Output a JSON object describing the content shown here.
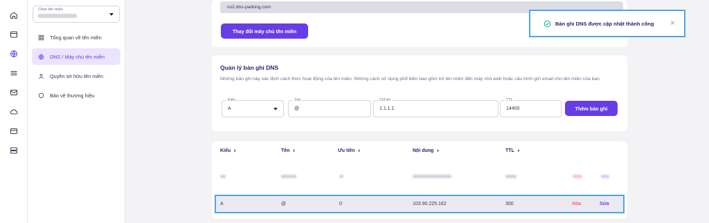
{
  "rail": {
    "icons": [
      "home-icon",
      "browser-icon",
      "globe-icon",
      "waves-icon",
      "mail-icon",
      "cloud-icon",
      "card-icon",
      "server-icon"
    ]
  },
  "sidebar": {
    "domain_select_label": "Chọn tên miền",
    "items": [
      {
        "label": "Tổng quan về tên miền",
        "icon": "grid-icon"
      },
      {
        "label": "DNS / Máy chủ tên miền",
        "icon": "globe-icon",
        "active": true
      },
      {
        "label": "Quyền sở hữu tên miền",
        "icon": "user-icon"
      },
      {
        "label": "Bảo vệ thương hiệu",
        "icon": "shield-icon"
      }
    ]
  },
  "nameservers": {
    "ns2_value": "ns2.dns-parking.com",
    "change_button": "Thay đổi máy chủ tên miền"
  },
  "dns_manager": {
    "title": "Quản lý bản ghi DNS",
    "description": "Những bản ghi này xác định cách thức hoạt động của tên miền. Những cách sử dụng phổ biến bao gồm trỏ tên miền đến máy chủ web hoặc cấu hình gửi email cho tên miền của bạn.",
    "form": {
      "type_label": "Kiểu",
      "type_value": "A",
      "name_label": "Tên",
      "name_value": "@",
      "points_label": "Chỉ tới",
      "points_value": "1.1.1.1",
      "ttl_label": "TTL",
      "ttl_value": "14400",
      "add_button": "Thêm bản ghi"
    }
  },
  "table": {
    "headers": [
      "Kiểu",
      "Tên",
      "Ưu tiên",
      "Nội dung",
      "TTL"
    ],
    "row": {
      "type": "A",
      "name": "@",
      "priority": "0",
      "content": "103.90.225.162",
      "ttl": "300"
    },
    "delete_label": "Xóa",
    "edit_label": "Sửa"
  },
  "toast": {
    "message": "Bản ghi DNS được cập nhật thành công",
    "close": "×"
  },
  "colors": {
    "primary": "#673de6",
    "danger": "#fc5185",
    "highlight": "#4ea5e0",
    "success": "#00b090"
  }
}
